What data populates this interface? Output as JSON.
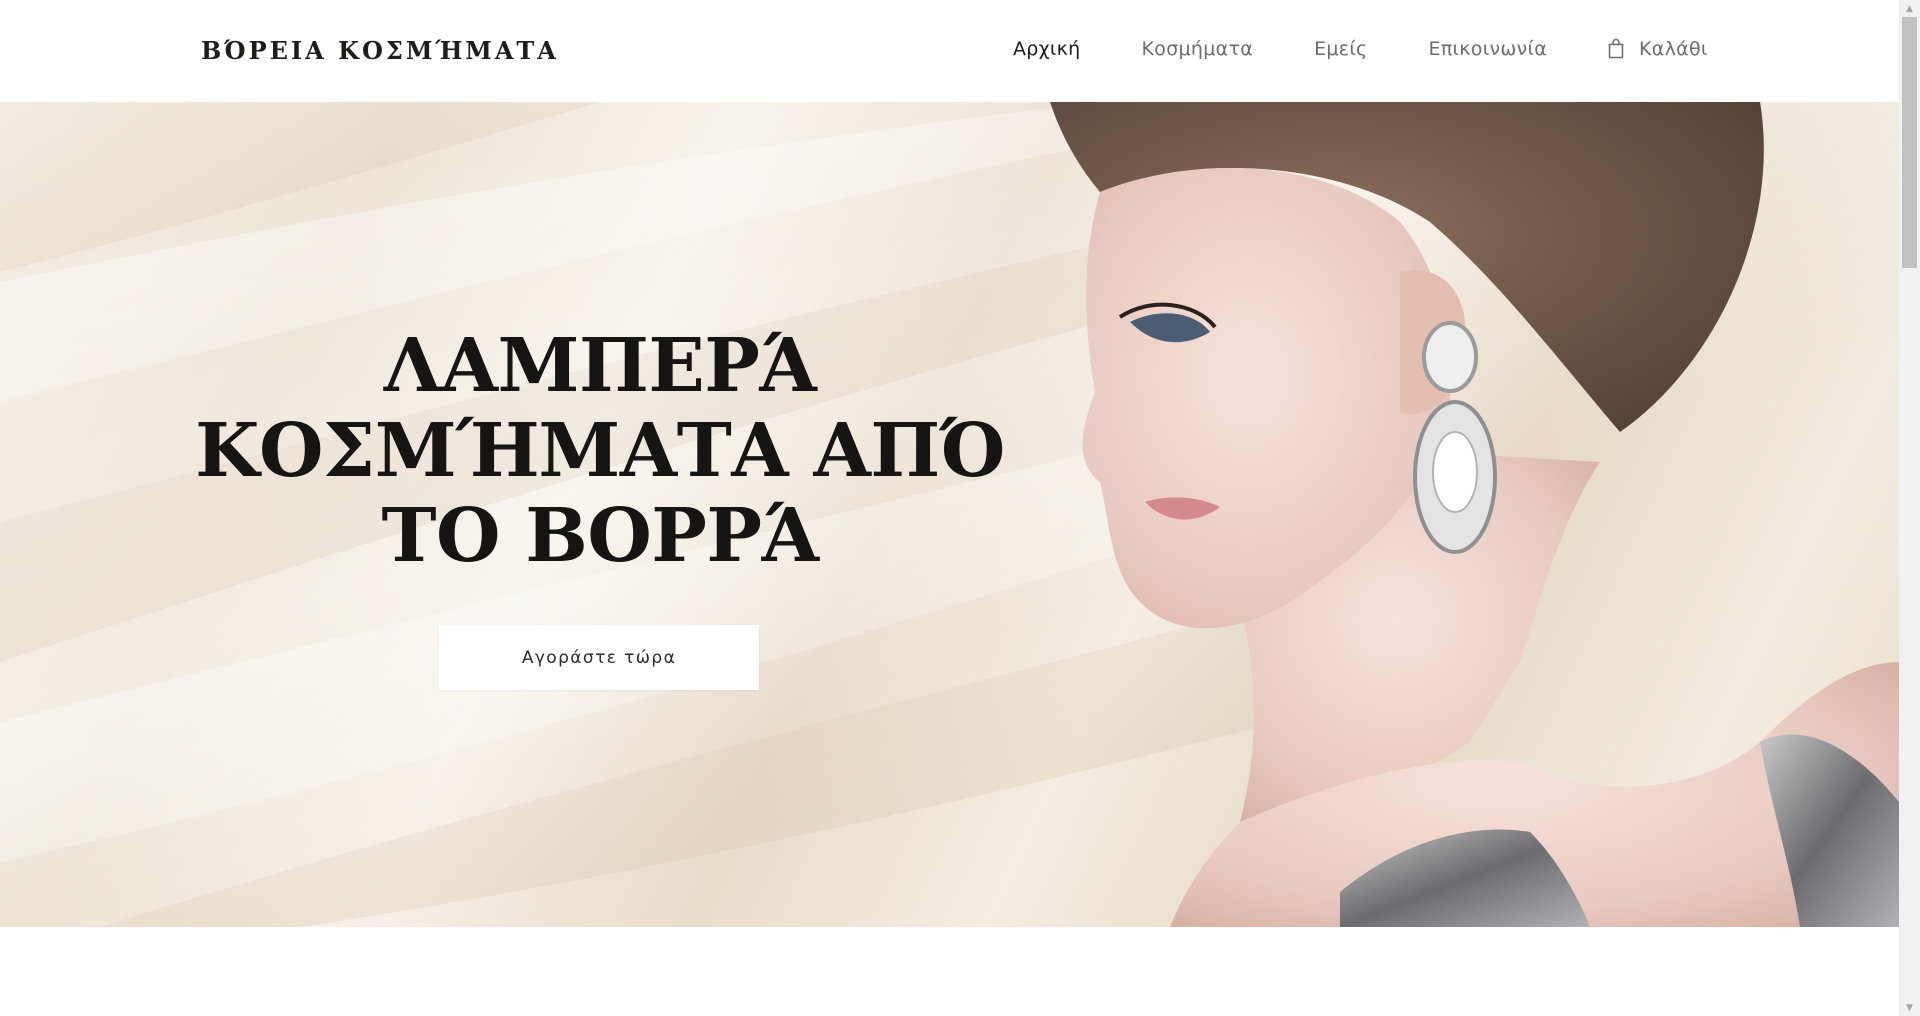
{
  "header": {
    "logo": "ΒΌΡΕΙΑ ΚΟΣΜΉΜΑΤΑ",
    "nav": [
      {
        "label": "Αρχική",
        "active": true
      },
      {
        "label": "Κοσμήματα",
        "active": false
      },
      {
        "label": "Εμείς",
        "active": false
      },
      {
        "label": "Επικοινωνία",
        "active": false
      }
    ],
    "cart": {
      "label": "Καλάθι",
      "icon": "shopping-bag-icon"
    }
  },
  "hero": {
    "title_lines": [
      "ΛΑΜΠΕΡΆ",
      "ΚΟΣΜΉΜΑΤΑ ΑΠΌ",
      "ΤΟ ΒΟΡΡΆ"
    ],
    "button_label": "Αγοράστε τώρα",
    "image": "woman-with-diamond-earring-photo"
  },
  "colors": {
    "text_dark": "#1c1c1c",
    "nav_inactive": "#6d6d6d",
    "hero_background": "#efe6d8",
    "button_background": "#ffffff"
  }
}
